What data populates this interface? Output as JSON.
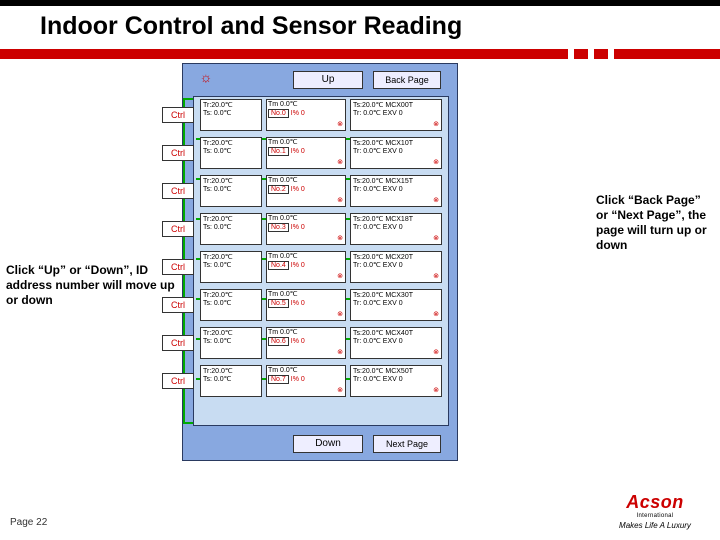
{
  "title": "Indoor Control and Sensor Reading",
  "note_left": "Click “Up” or “Down”, ID address number will move up or down",
  "note_right": "Click “Back Page” or “Next Page”, the page will turn up or down",
  "btns": {
    "up": "Up",
    "down": "Down",
    "back": "Back Page",
    "next": "Next Page"
  },
  "ctrl_label": "Ctrl",
  "rows": [
    {
      "no": "No.0",
      "mcx": "MCX00T"
    },
    {
      "no": "No.1",
      "mcx": "MCX10T"
    },
    {
      "no": "No.2",
      "mcx": "MCX15T"
    },
    {
      "no": "No.3",
      "mcx": "MCX18T"
    },
    {
      "no": "No.4",
      "mcx": "MCX20T"
    },
    {
      "no": "No.5",
      "mcx": "MCX30T"
    },
    {
      "no": "No.6",
      "mcx": "MCX40T"
    },
    {
      "no": "No.7",
      "mcx": "MCX50T"
    }
  ],
  "cell_a_l1": "Tr:20.0℃",
  "cell_a_l2": "Ts: 0.0℃",
  "cell_b_tm": "Tm 0.0℃",
  "cell_b_ic": "I% 0",
  "cell_c_l1": "Ts:20.0℃",
  "cell_c_l2": "Tr: 0.0℃",
  "cell_c_exv": "EXV 0",
  "page_label": "Page 22",
  "logo": {
    "name": "Acson",
    "sub": "International",
    "tag": "Makes Life A Luxury"
  }
}
